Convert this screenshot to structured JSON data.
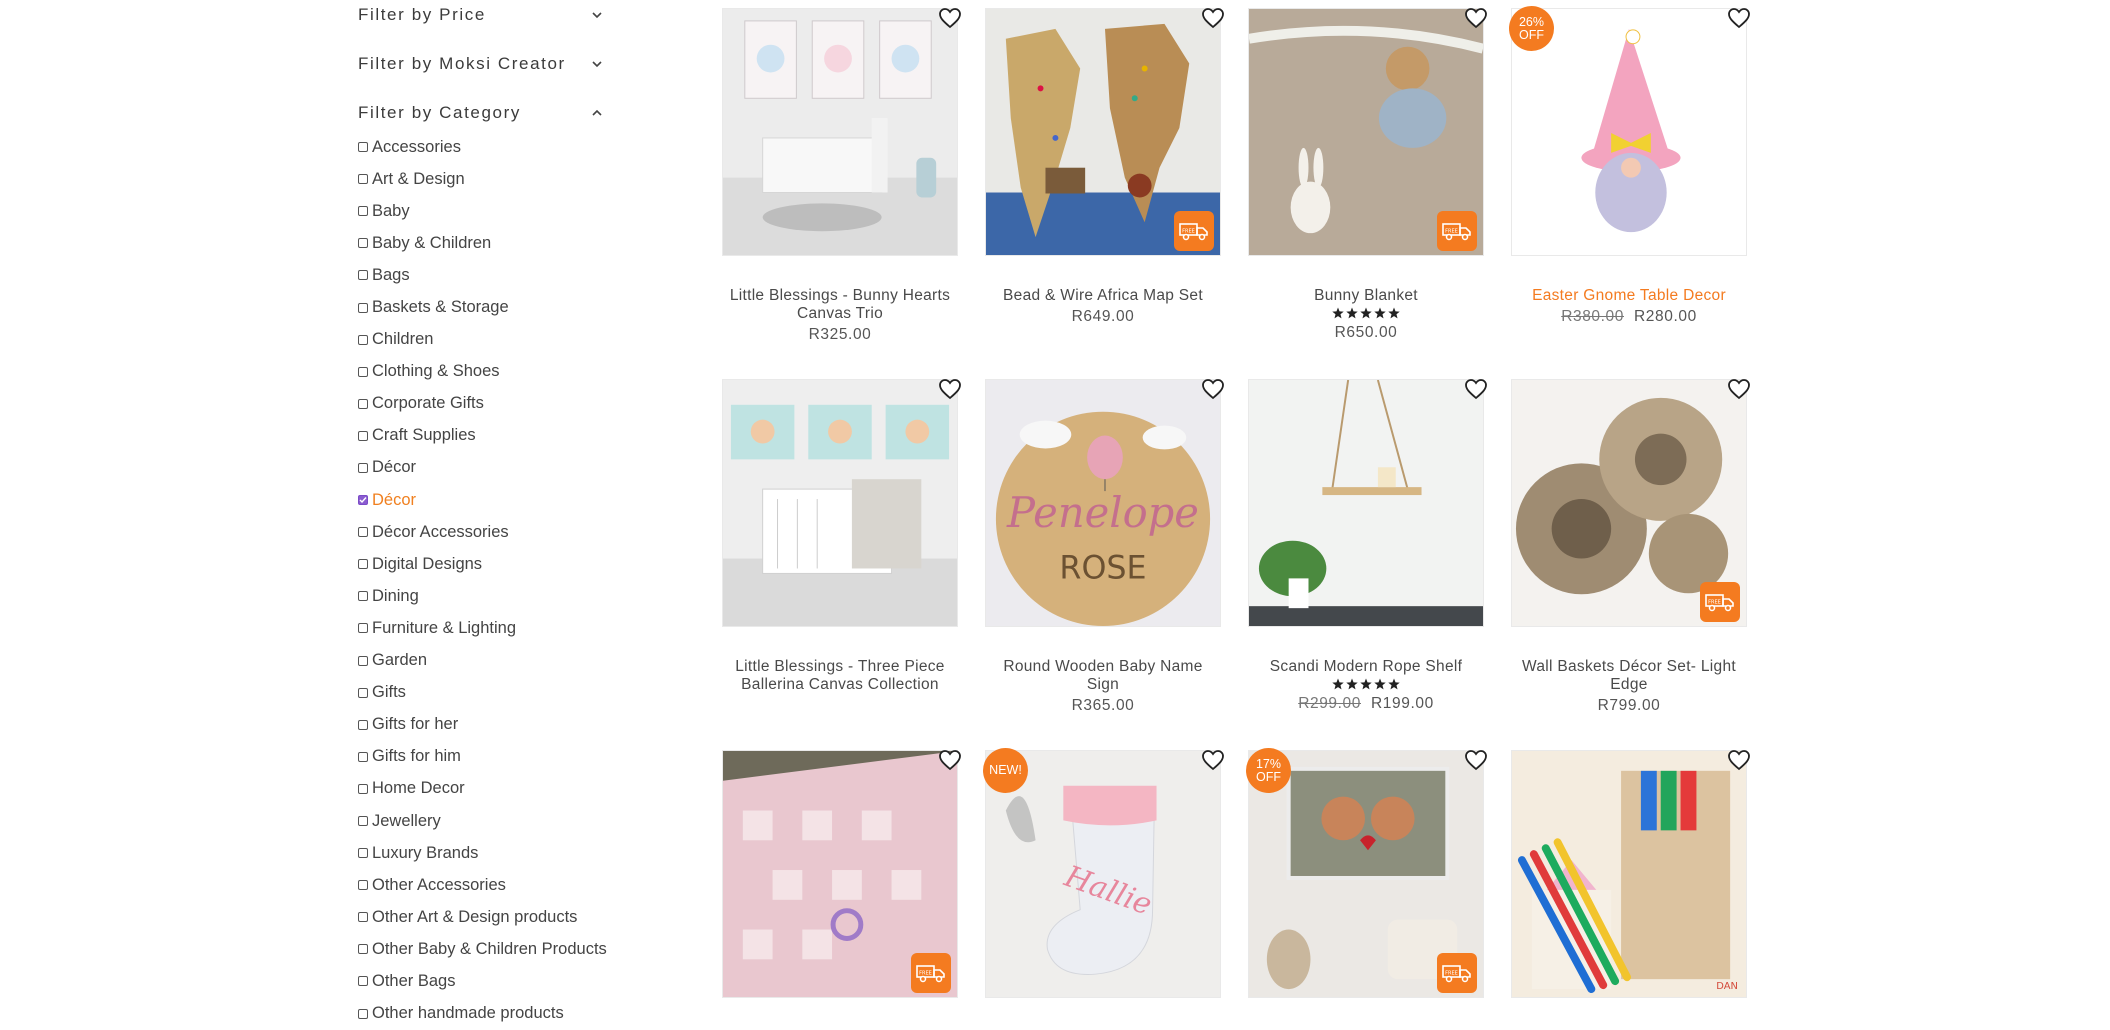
{
  "filters": {
    "price_label": "Filter by Price",
    "creator_label": "Filter by Moksi Creator",
    "category_label": "Filter by Category"
  },
  "categories": [
    {
      "label": "Accessories",
      "checked": false
    },
    {
      "label": "Art & Design",
      "checked": false
    },
    {
      "label": "Baby",
      "checked": false
    },
    {
      "label": "Baby & Children",
      "checked": false
    },
    {
      "label": "Bags",
      "checked": false
    },
    {
      "label": "Baskets & Storage",
      "checked": false
    },
    {
      "label": "Children",
      "checked": false
    },
    {
      "label": "Clothing & Shoes",
      "checked": false
    },
    {
      "label": "Corporate Gifts",
      "checked": false
    },
    {
      "label": "Craft Supplies",
      "checked": false
    },
    {
      "label": "Décor",
      "checked": false
    },
    {
      "label": "Décor",
      "checked": true
    },
    {
      "label": "Décor Accessories",
      "checked": false
    },
    {
      "label": "Digital Designs",
      "checked": false
    },
    {
      "label": "Dining",
      "checked": false
    },
    {
      "label": "Furniture & Lighting",
      "checked": false
    },
    {
      "label": "Garden",
      "checked": false
    },
    {
      "label": "Gifts",
      "checked": false
    },
    {
      "label": "Gifts for her",
      "checked": false
    },
    {
      "label": "Gifts for him",
      "checked": false
    },
    {
      "label": "Home Decor",
      "checked": false
    },
    {
      "label": "Jewellery",
      "checked": false
    },
    {
      "label": "Luxury Brands",
      "checked": false
    },
    {
      "label": "Other Accessories",
      "checked": false
    },
    {
      "label": "Other Art & Design products",
      "checked": false
    },
    {
      "label": "Other Baby & Children Products",
      "checked": false
    },
    {
      "label": "Other Bags",
      "checked": false
    },
    {
      "label": "Other handmade products",
      "checked": false
    }
  ],
  "products": [
    {
      "title": "Little Blessings - Bunny Hearts Canvas Trio",
      "price": "R325.00",
      "old_price": "",
      "badge": "",
      "free_delivery": false,
      "rating": 0,
      "highlight": false,
      "art": "nursery-bunny"
    },
    {
      "title": "Bead & Wire Africa Map Set",
      "price": "R649.00",
      "old_price": "",
      "badge": "",
      "free_delivery": true,
      "rating": 0,
      "highlight": false,
      "art": "africa-map"
    },
    {
      "title": "Bunny Blanket",
      "price": "R650.00",
      "old_price": "",
      "badge": "",
      "free_delivery": true,
      "rating": 5,
      "highlight": false,
      "art": "bunny-blanket"
    },
    {
      "title": "Easter Gnome Table Decor",
      "price": "R280.00",
      "old_price": "R380.00",
      "badge": "26%\nOFF",
      "free_delivery": false,
      "rating": 0,
      "highlight": true,
      "art": "gnome"
    },
    {
      "title": "Little Blessings - Three Piece Ballerina Canvas Collection",
      "price": "",
      "old_price": "",
      "badge": "",
      "free_delivery": false,
      "rating": 0,
      "highlight": false,
      "art": "nursery-ballerina"
    },
    {
      "title": "Round Wooden Baby Name Sign",
      "price": "R365.00",
      "old_price": "",
      "badge": "",
      "free_delivery": false,
      "rating": 0,
      "highlight": false,
      "art": "name-sign"
    },
    {
      "title": "Scandi Modern Rope Shelf",
      "price": "R199.00",
      "old_price": "R299.00",
      "badge": "",
      "free_delivery": false,
      "rating": 5,
      "highlight": false,
      "art": "rope-shelf"
    },
    {
      "title": "Wall Baskets Décor Set- Light Edge",
      "price": "R799.00",
      "old_price": "",
      "badge": "",
      "free_delivery": true,
      "rating": 0,
      "highlight": false,
      "art": "baskets"
    },
    {
      "title": "",
      "price": "",
      "old_price": "",
      "badge": "",
      "free_delivery": true,
      "rating": 0,
      "highlight": false,
      "art": "pink-blanket"
    },
    {
      "title": "",
      "price": "",
      "old_price": "",
      "badge": "NEW!",
      "free_delivery": false,
      "rating": 0,
      "highlight": false,
      "art": "stocking"
    },
    {
      "title": "",
      "price": "",
      "old_price": "",
      "badge": "17%\nOFF",
      "free_delivery": true,
      "rating": 0,
      "highlight": false,
      "art": "painting"
    },
    {
      "title": "",
      "price": "",
      "old_price": "",
      "badge": "",
      "free_delivery": false,
      "rating": 0,
      "highlight": false,
      "art": "paint-set"
    }
  ],
  "colors": {
    "accent": "#f47b20",
    "check": "#8a5cd0"
  },
  "art_labels": {
    "name_first": "Penelope",
    "name_last": "ROSE",
    "stocking_name": "Hallie",
    "corner_text": "DAN",
    "truck_text": "FREE"
  }
}
